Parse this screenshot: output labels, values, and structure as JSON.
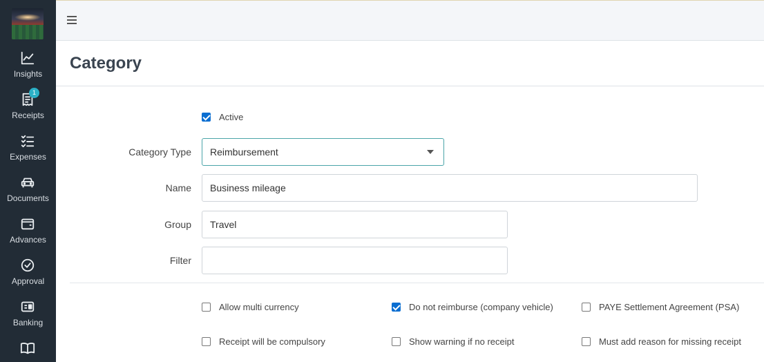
{
  "nav": {
    "items": [
      {
        "label": "Insights",
        "icon": "chart-line-icon"
      },
      {
        "label": "Receipts",
        "icon": "receipt-icon",
        "badge": "1"
      },
      {
        "label": "Expenses",
        "icon": "checklist-icon"
      },
      {
        "label": "Documents",
        "icon": "car-icon"
      },
      {
        "label": "Advances",
        "icon": "wallet-icon"
      },
      {
        "label": "Approval",
        "icon": "check-circle-icon"
      },
      {
        "label": "Banking",
        "icon": "bank-card-icon"
      },
      {
        "label": "",
        "icon": "book-icon"
      }
    ]
  },
  "header": {
    "title": "Category"
  },
  "form": {
    "active_label": "Active",
    "active_checked": true,
    "category_type_label": "Category Type",
    "category_type_value": "Reimbursement",
    "name_label": "Name",
    "name_value": "Business mileage",
    "group_label": "Group",
    "group_value": "Travel",
    "filter_label": "Filter",
    "filter_value": ""
  },
  "options": [
    {
      "label": "Allow multi currency",
      "checked": false
    },
    {
      "label": "Do not reimburse (company vehicle)",
      "checked": true
    },
    {
      "label": "PAYE Settlement Agreement (PSA)",
      "checked": false
    },
    {
      "label": "Receipt will be compulsory",
      "checked": false
    },
    {
      "label": "Show warning if no receipt",
      "checked": false
    },
    {
      "label": "Must add reason for missing receipt",
      "checked": false
    }
  ],
  "colors": {
    "sidebar": "#222c36",
    "accent": "#0a6ed1",
    "badge": "#2bb0c6"
  }
}
